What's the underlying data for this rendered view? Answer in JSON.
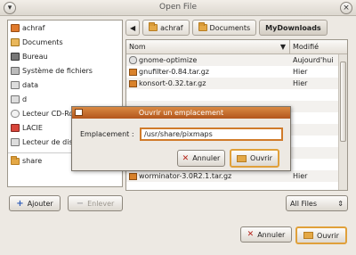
{
  "window": {
    "title": "Open File"
  },
  "path_bar": {
    "crumbs": [
      "achraf",
      "Documents",
      "MyDownloads"
    ],
    "active_index": 2
  },
  "places": [
    {
      "label": "achraf",
      "icon": "home-icon"
    },
    {
      "label": "Documents",
      "icon": "documents-folder-icon"
    },
    {
      "label": "Bureau",
      "icon": "desktop-icon"
    },
    {
      "label": "Système de fichiers",
      "icon": "filesystem-icon"
    },
    {
      "label": "data",
      "icon": "drive-icon"
    },
    {
      "label": "d",
      "icon": "drive-icon"
    },
    {
      "label": "Lecteur CD-Ro",
      "icon": "cdrom-icon"
    },
    {
      "label": "LACIE",
      "icon": "external-drive-icon"
    },
    {
      "label": "Lecteur de dis",
      "icon": "drive-icon"
    },
    {
      "label": "share",
      "icon": "folder-icon"
    }
  ],
  "files": {
    "header_name": "Nom",
    "header_modified": "Modifié",
    "rows": [
      {
        "name": "gnome-optimize",
        "modified": "Aujourd'hui",
        "icon": "executable-icon"
      },
      {
        "name": "gnufilter-0.84.tar.gz",
        "modified": "Hier",
        "icon": "archive-icon"
      },
      {
        "name": "konsort-0.32.tar.gz",
        "modified": "Hier",
        "icon": "archive-icon"
      },
      {
        "name": "",
        "modified": "",
        "icon": ""
      },
      {
        "name": "",
        "modified": "",
        "icon": ""
      },
      {
        "name": "",
        "modified": "",
        "icon": ""
      },
      {
        "name": "",
        "modified": "",
        "icon": ""
      },
      {
        "name": "",
        "modified": "",
        "icon": ""
      },
      {
        "name": "",
        "modified": "",
        "icon": ""
      },
      {
        "name": "",
        "modified": "",
        "icon": ""
      },
      {
        "name": "worminator-3.0R2.1.tar.gz",
        "modified": "Hier",
        "icon": "archive-icon"
      }
    ]
  },
  "left_buttons": {
    "add": "Ajouter",
    "remove": "Enlever"
  },
  "filter": {
    "value": "All Files"
  },
  "bottom_buttons": {
    "cancel": "Annuler",
    "open": "Ouvrir"
  },
  "location_dialog": {
    "title": "Ouvrir un emplacement",
    "label": "Emplacement :",
    "value": "/usr/share/pixmaps",
    "cancel": "Annuler",
    "open": "Ouvrir"
  },
  "colors": {
    "accent": "#d07b2a",
    "dialog_title": "#c26b2c"
  }
}
